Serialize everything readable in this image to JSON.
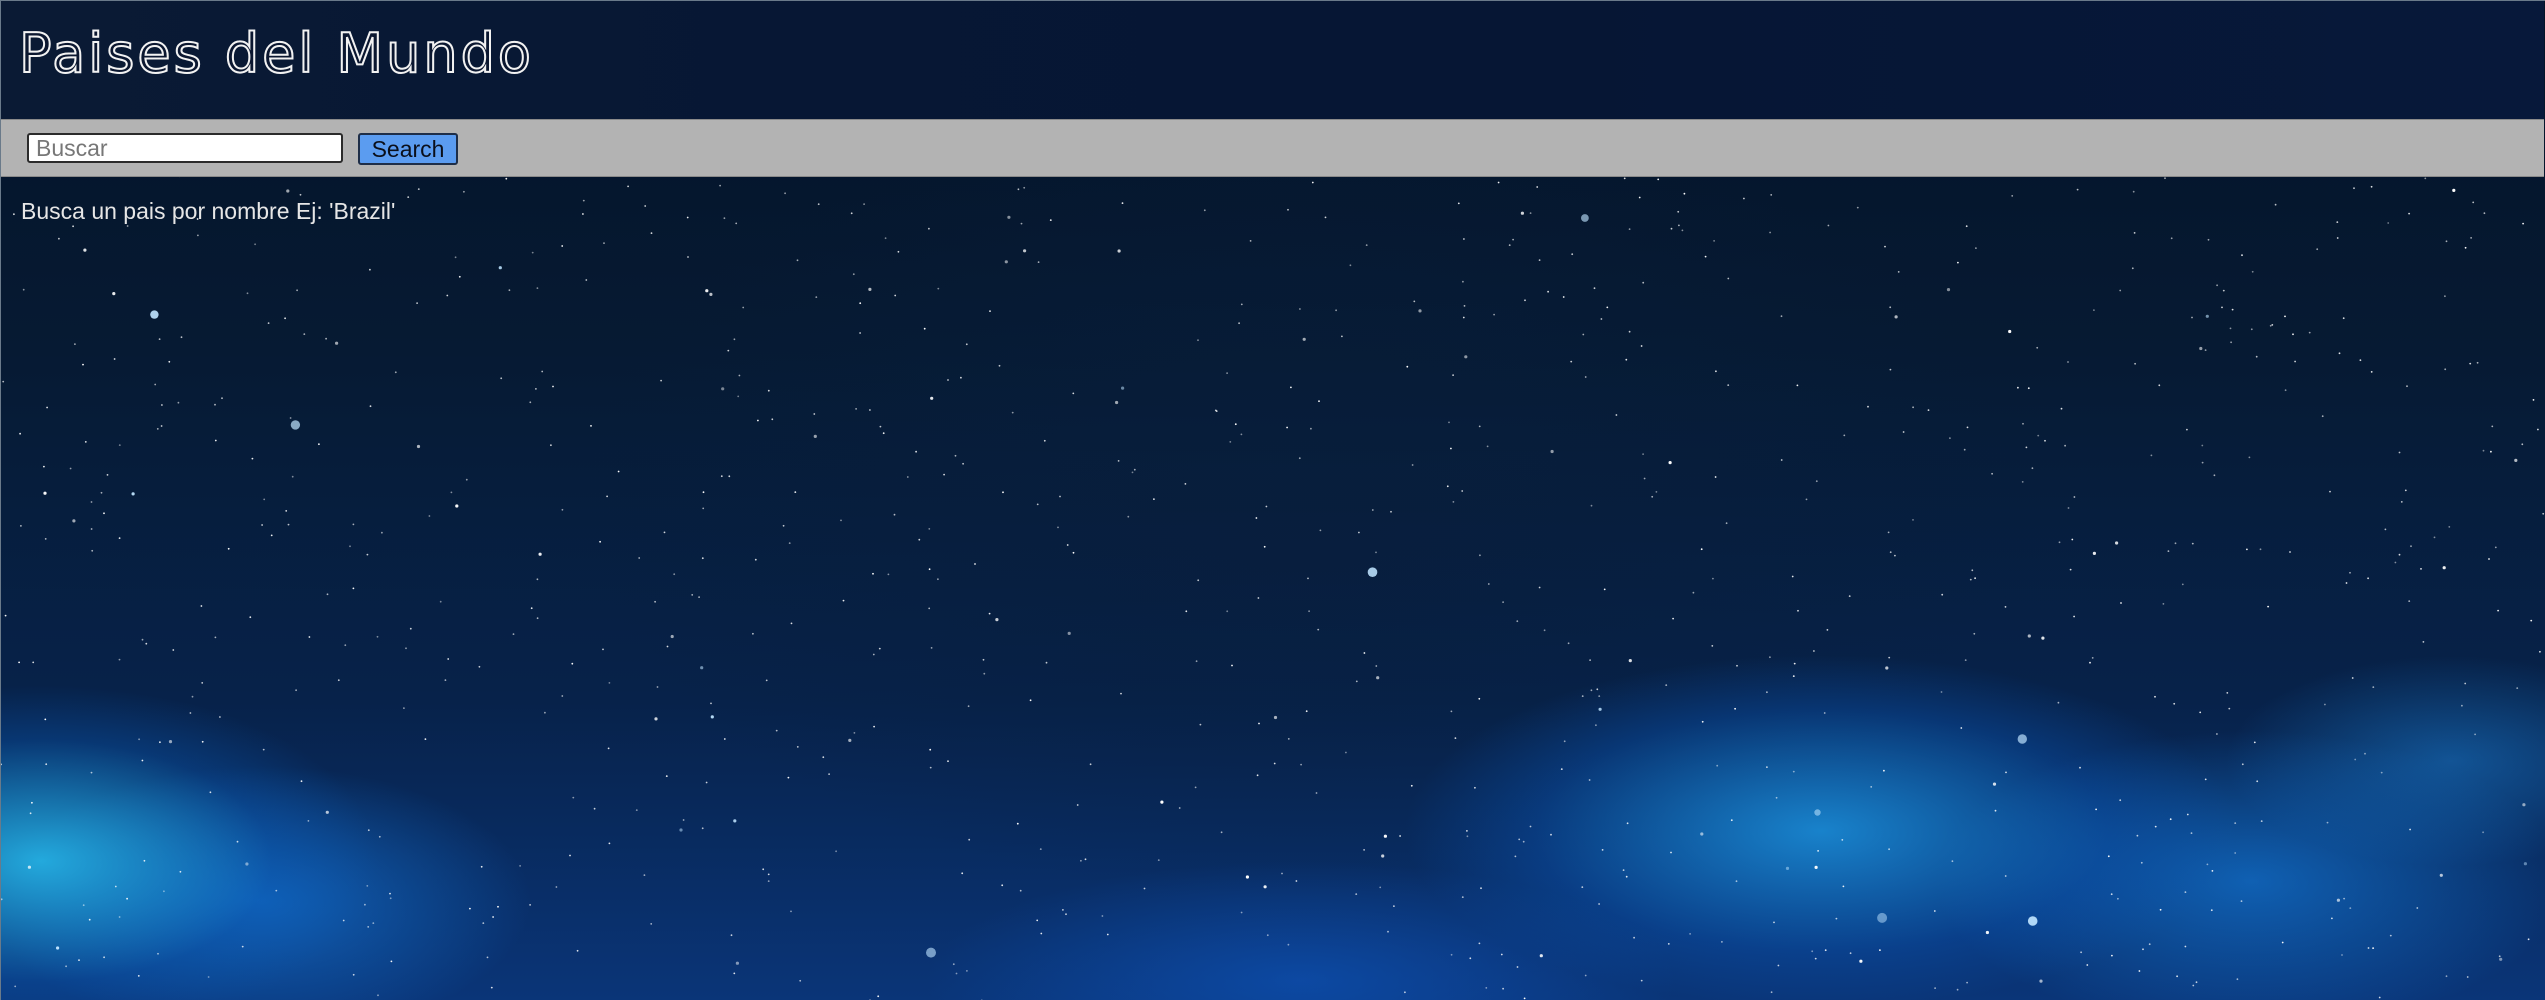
{
  "header": {
    "title": "Paises del Mundo"
  },
  "search": {
    "placeholder": "Buscar",
    "value": "",
    "button_label": "Search"
  },
  "main": {
    "hint": "Busca un pais por nombre Ej: 'Brazil'"
  },
  "colors": {
    "header_bg": "#071734",
    "search_bar_bg": "#b3b3b3",
    "button_bg": "#5b9cf0",
    "text": "#e6e6e6"
  }
}
